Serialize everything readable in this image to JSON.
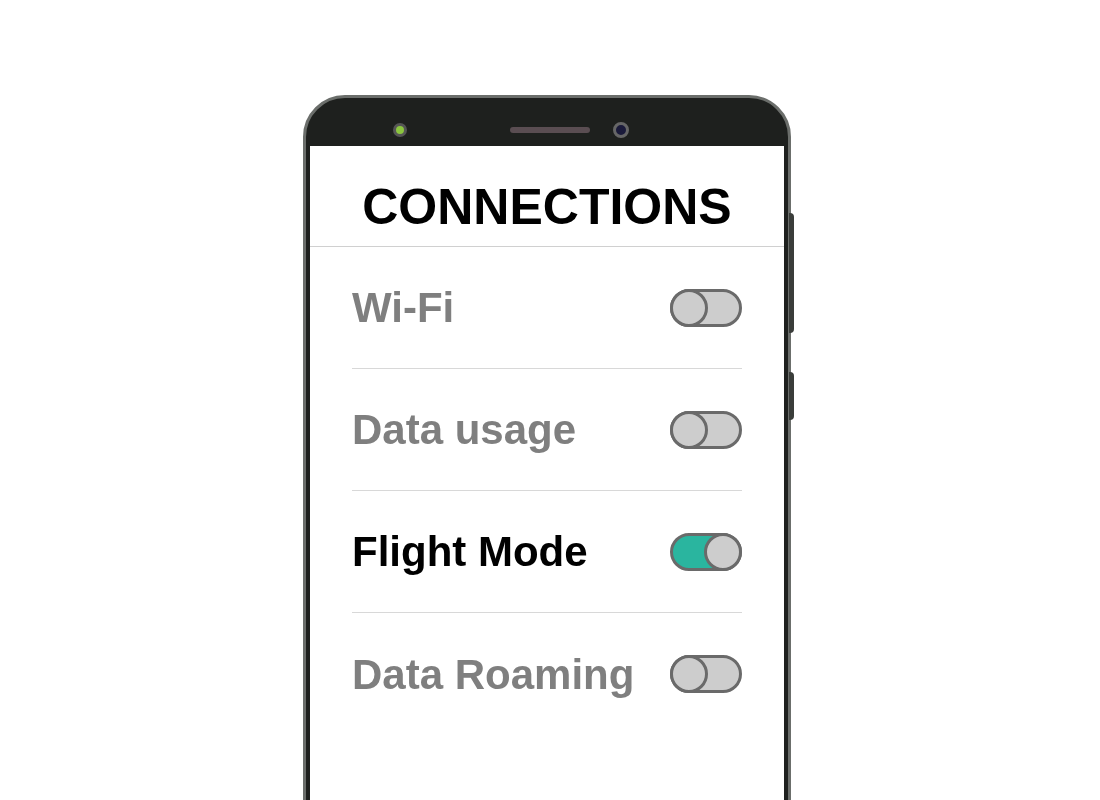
{
  "screen": {
    "title": "CONNECTIONS"
  },
  "settings": [
    {
      "label": "Wi-Fi",
      "on": false
    },
    {
      "label": "Data usage",
      "on": false
    },
    {
      "label": "Flight Mode",
      "on": true
    },
    {
      "label": "Data Roaming",
      "on": false
    }
  ]
}
